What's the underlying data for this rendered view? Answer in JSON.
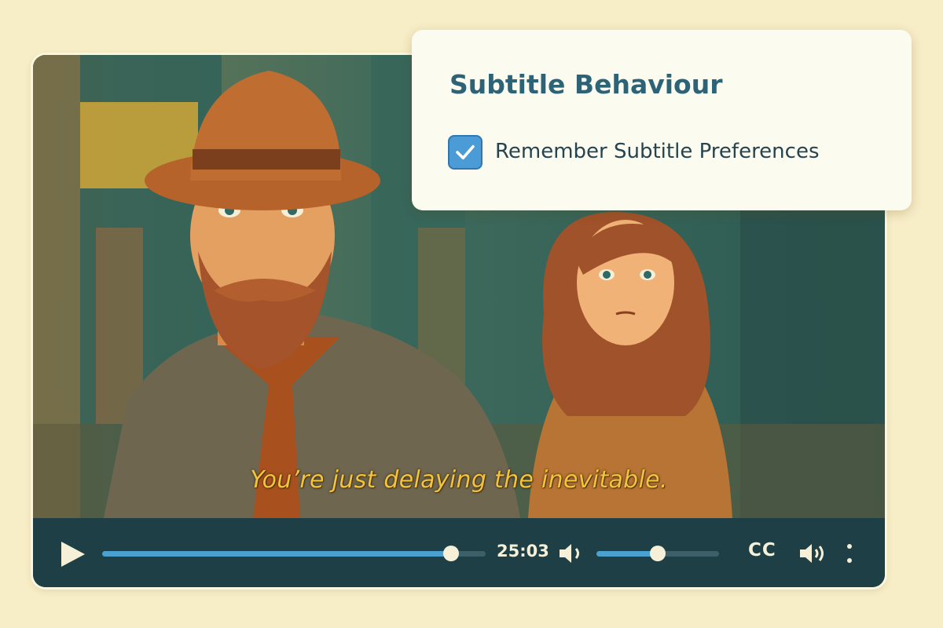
{
  "video": {
    "subtitle_text": "You’re just delaying the inevitable.",
    "scene_description_icon": "video-frame"
  },
  "controls": {
    "play_icon": "play-icon",
    "progress_fraction": 0.91,
    "current_time": "25:03",
    "volume_icon": "volume-icon",
    "volume_fraction": 0.5,
    "cc_label": "CC",
    "speaker_icon": "speaker-icon",
    "more_icon": "more-vertical-icon"
  },
  "subtitle_panel": {
    "title": "Subtitle Behaviour",
    "remember_label": "Remember Subtitle Preferences",
    "remember_checked": true
  },
  "colors": {
    "accent": "#4aa1d0",
    "panel_title": "#2d6377",
    "subtitle": "#f2c43a",
    "control_bar": "#1d3f45"
  }
}
